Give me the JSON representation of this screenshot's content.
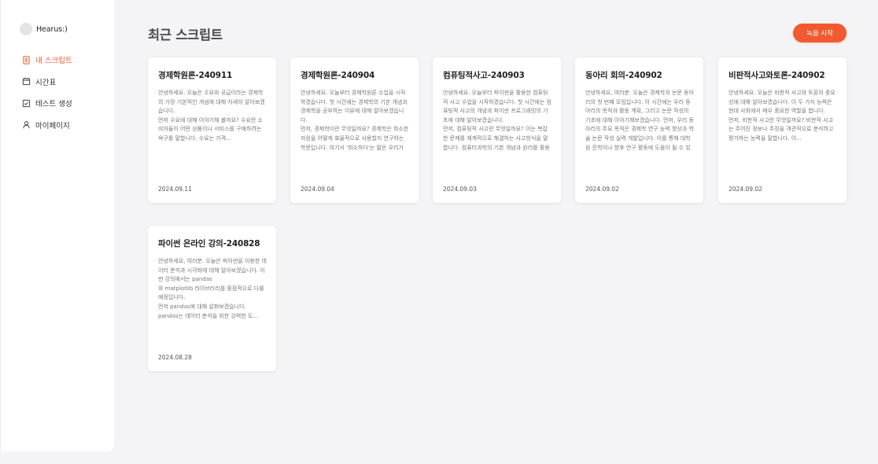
{
  "sidebar": {
    "profile_name": "Hearus:)",
    "items": [
      {
        "label": "내 스크립트",
        "icon": "script-icon",
        "active": true
      },
      {
        "label": "시간표",
        "icon": "calendar-icon",
        "active": false
      },
      {
        "label": "테스트 생성",
        "icon": "checkbox-icon",
        "active": false
      },
      {
        "label": "마이페이지",
        "icon": "user-icon",
        "active": false
      }
    ]
  },
  "main": {
    "title": "최근 스크립트",
    "record_button": "녹음 시작",
    "accent_color": "#f15a30"
  },
  "cards": [
    {
      "title": "경제학원론-240911",
      "body": "안녕하세요. 오늘은 수요와 공급이라는 경제학의 가장 기본적인 개념에 대해 자세히 알아보겠습니다.\n먼저 수요에 대해 이야기해 볼까요? 수요란 소비자들이 어떤 상품이나 서비스를 구매하려는 욕구를 말합니다. 수요는 가격...",
      "date": "2024.09.11"
    },
    {
      "title": "경제학원론-240904",
      "body": "안녕하세요. 오늘부터 경제학원론 수업을 시작하겠습니다. 첫 시간에는 경제학의 기본 개념과 경제학을 공부하는 이유에 대해 알아보겠습니다.\n먼저, 경제학이란 무엇일까요? 경제학은 희소한 자원을 어떻게 효율적으로 사용할지 연구하는 학문입니다. 여기서 '희소하다'는 말은 우리가 원하는 모든 것을 가질 수 없...",
      "date": "2024.09.04"
    },
    {
      "title": "컴퓨팅적사고-240903",
      "body": "안녕하세요. 오늘부터 파이썬을 활용한 컴퓨팅적 사고 수업을 시작하겠습니다. 첫 시간에는 컴퓨팅적 사고의 개념과 파이썬 프로그래밍의 기초에 대해 알아보겠습니다.\n먼저, 컴퓨팅적 사고란 무엇일까요? 이는 복잡한 문제를 체계적으로 해결하는 사고방식을 말합니다. 컴퓨터과학의 기본 개념과 원리를 활용하여 문제를 해결하고, 시...",
      "date": "2024.09.03"
    },
    {
      "title": "동아리 회의-240902",
      "body": "안녕하세요, 여러분. 오늘은 경제학과 논문 동아리의 첫 번째 모임입니다. 이 시간에는 우리 동아리의 목적과 활동 계획, 그리고 논문 작성의 기초에 대해 이야기해보겠습니다. 먼저, 우리 동아리의 주요 목적은 경제학 연구 능력 향상과 학술 논문 작성 실력 개발입니다. 이를 통해 대학원 진학이나 향후 연구 활동에 도움이 될 수 있는 기반을...",
      "date": "2024.09.02"
    },
    {
      "title": "비판적사고와토론-240902",
      "body": "안녕하세요. 오늘은 비판적 사고와 토론의 중요성에 대해 알아보겠습니다. 이 두 가지 능력은 현대 사회에서 매우 중요한 역할을 합니다.\n먼저, 비판적 사고란 무엇일까요? 비판적 사고는 주어진 정보나 주장을 객관적으로 분석하고 평가하는 능력을 말합니다. 이...",
      "date": "2024.09.02"
    },
    {
      "title": "파이썬 온라인 강의-240828",
      "body": "안녕하세요, 여러분. 오늘은 파이썬을 이용한 데이터 분석과 시각화에 대해 알아보겠습니다. 이번 강의에서는 pandas\n와 matplotlib 라이브러리를 중점적으로 다룰 예정입니다.\n먼저 pandas에 대해 살펴보겠습니다.\npandas는 데이터 분석을 위한 강력한 도...",
      "date": "2024.08.28"
    }
  ]
}
